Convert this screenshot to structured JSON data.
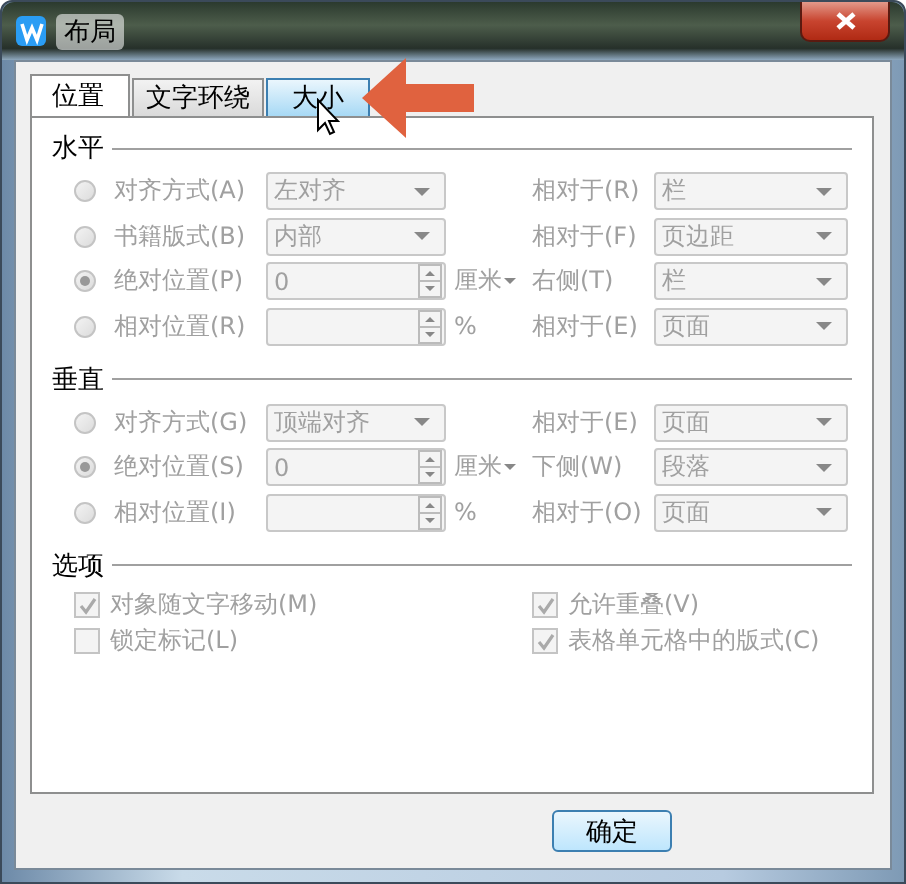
{
  "window": {
    "title": "布局"
  },
  "tabs": [
    {
      "label": "位置",
      "selected": true,
      "hovered": false
    },
    {
      "label": "文字环绕",
      "selected": false,
      "hovered": false
    },
    {
      "label": "大小",
      "selected": false,
      "hovered": true
    }
  ],
  "sections": [
    {
      "title": "水平",
      "rows": [
        {
          "label": "对齐方式(A)",
          "selected": false,
          "disabled": true,
          "field": {
            "kind": "combo",
            "value": "左对齐"
          },
          "relative_label": "相对于(R)",
          "relative_value": "栏"
        },
        {
          "label": "书籍版式(B)",
          "selected": false,
          "disabled": true,
          "field": {
            "kind": "combo",
            "value": "内部"
          },
          "relative_label": "相对于(F)",
          "relative_value": "页边距"
        },
        {
          "label": "绝对位置(P)",
          "selected": true,
          "disabled": true,
          "field": {
            "kind": "spin",
            "value": "0",
            "unit": "厘米",
            "unit_dropdown": true
          },
          "relative_label": "右侧(T)",
          "relative_value": "栏"
        },
        {
          "label": "相对位置(R)",
          "selected": false,
          "disabled": true,
          "field": {
            "kind": "spin",
            "unit": "%",
            "unit_dropdown": false
          },
          "relative_label": "相对于(E)",
          "relative_value": "页面"
        }
      ]
    },
    {
      "title": "垂直",
      "rows": [
        {
          "label": "对齐方式(G)",
          "selected": false,
          "disabled": true,
          "field": {
            "kind": "combo",
            "value": "顶端对齐"
          },
          "relative_label": "相对于(E)",
          "relative_value": "页面"
        },
        {
          "label": "绝对位置(S)",
          "selected": true,
          "disabled": true,
          "field": {
            "kind": "spin",
            "value": "0",
            "unit": "厘米",
            "unit_dropdown": true
          },
          "relative_label": "下侧(W)",
          "relative_value": "段落"
        },
        {
          "label": "相对位置(I)",
          "selected": false,
          "disabled": true,
          "field": {
            "kind": "spin",
            "unit": "%",
            "unit_dropdown": false
          },
          "relative_label": "相对于(O)",
          "relative_value": "页面"
        }
      ]
    }
  ],
  "options": {
    "title": "选项",
    "items": [
      {
        "label": "对象随文字移动(M)",
        "checked": true,
        "disabled": true
      },
      {
        "label": "允许重叠(V)",
        "checked": true,
        "disabled": true
      },
      {
        "label": "锁定标记(L)",
        "checked": false,
        "disabled": true
      },
      {
        "label": "表格单元格中的版式(C)",
        "checked": true,
        "disabled": true
      }
    ]
  },
  "buttons": [
    {
      "label": "确定"
    }
  ]
}
